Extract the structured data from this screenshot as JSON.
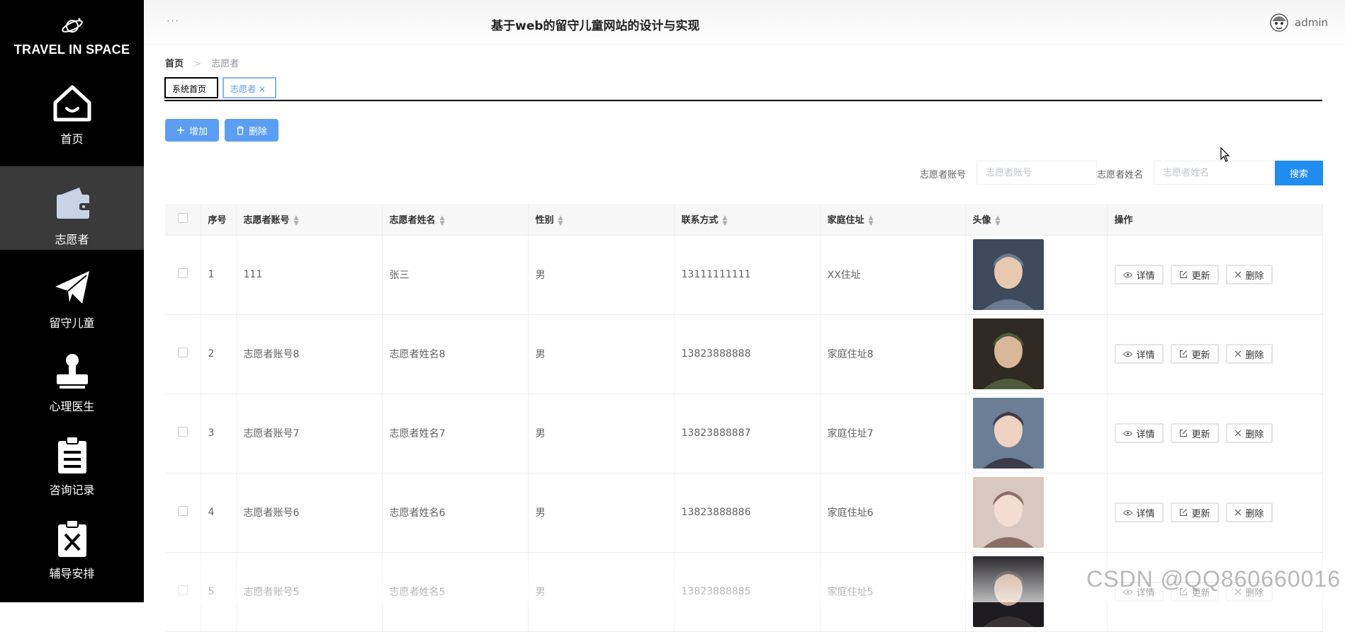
{
  "sidebar": {
    "brand": "TRAVEL IN SPACE",
    "items": [
      {
        "label": "首页",
        "icon": "home-icon"
      },
      {
        "label": "志愿者",
        "icon": "wallet-icon",
        "active": true
      },
      {
        "label": "留守儿童",
        "icon": "paper-plane-icon"
      },
      {
        "label": "心理医生",
        "icon": "stamp-icon"
      },
      {
        "label": "咨询记录",
        "icon": "clipboard-icon"
      },
      {
        "label": "辅导安排",
        "icon": "clipboard-x-icon"
      }
    ]
  },
  "header": {
    "menu": "···",
    "title": "基于web的留守儿童网站的设计与实现",
    "username": "admin"
  },
  "breadcrumb": {
    "home": "首页",
    "separator": ">",
    "current": "志愿者"
  },
  "tags": {
    "system_home": "系统首页",
    "current": "志愿者"
  },
  "toolbar": {
    "add": "增加",
    "delete": "删除"
  },
  "search": {
    "account_label": "志愿者账号",
    "account_placeholder": "志愿者账号",
    "name_label": "志愿者姓名",
    "name_placeholder": "志愿者姓名",
    "button": "搜索"
  },
  "table": {
    "columns": [
      "序号",
      "志愿者账号",
      "志愿者姓名",
      "性别",
      "联系方式",
      "家庭住址",
      "头像",
      "操作"
    ],
    "rows": [
      {
        "index": "1",
        "account": "111",
        "name": "张三",
        "gender": "男",
        "phone": "13111111111",
        "address": "XX住址"
      },
      {
        "index": "2",
        "account": "志愿者账号8",
        "name": "志愿者姓名8",
        "gender": "男",
        "phone": "13823888888",
        "address": "家庭住址8"
      },
      {
        "index": "3",
        "account": "志愿者账号7",
        "name": "志愿者姓名7",
        "gender": "男",
        "phone": "13823888887",
        "address": "家庭住址7"
      },
      {
        "index": "4",
        "account": "志愿者账号6",
        "name": "志愿者姓名6",
        "gender": "男",
        "phone": "13823888886",
        "address": "家庭住址6"
      },
      {
        "index": "5",
        "account": "志愿者账号5",
        "name": "志愿者姓名5",
        "gender": "男",
        "phone": "13823888885",
        "address": "家庭住址5"
      }
    ],
    "actions": {
      "detail": "详情",
      "update": "更新",
      "delete": "删除"
    }
  },
  "watermark": "CSDN @QQ860660016",
  "colors": {
    "sidebar_bg": "#000000",
    "primary_button": "#5b9ef3",
    "search_button": "#1e8cf0"
  }
}
